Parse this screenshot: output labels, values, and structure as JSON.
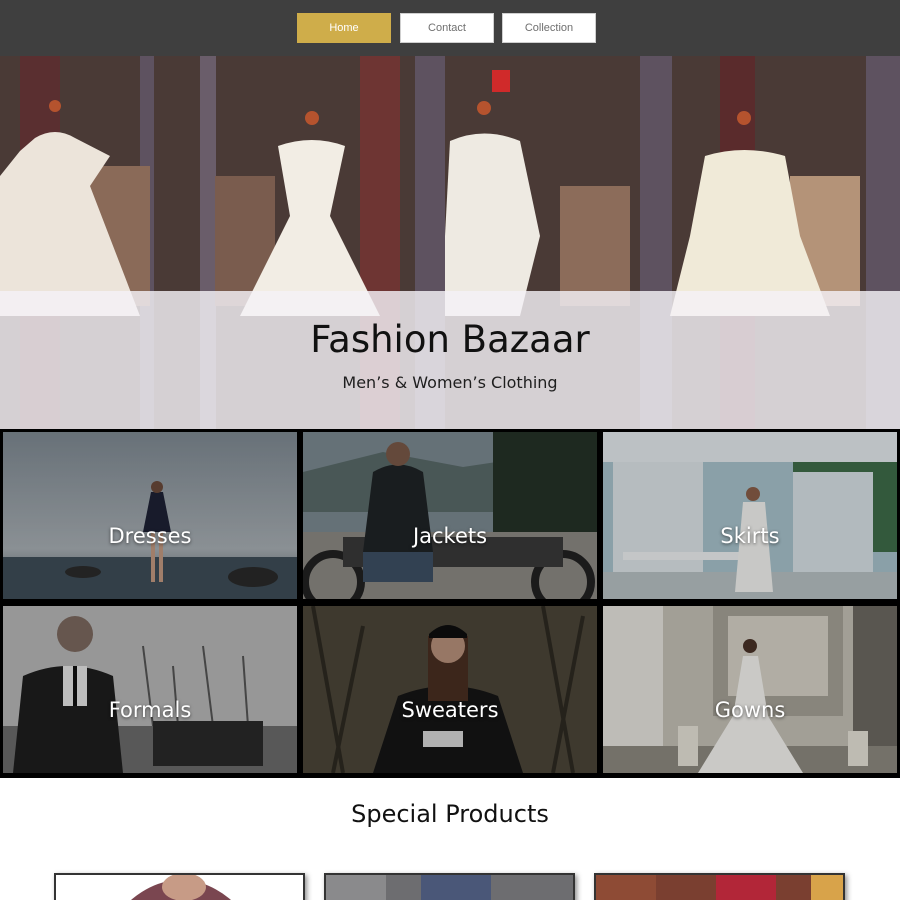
{
  "nav": {
    "items": [
      {
        "label": "Home",
        "active": true
      },
      {
        "label": "Contact",
        "active": false
      },
      {
        "label": "Collection",
        "active": false
      }
    ],
    "background": "#3f3f3f",
    "accent": "#cfad4a"
  },
  "hero": {
    "title": "Fashion Bazaar",
    "subtitle": "Men’s & Women’s Clothing"
  },
  "categories": [
    {
      "label": "Dresses",
      "icon": "photo-woman-dress-sea"
    },
    {
      "label": "Jackets",
      "icon": "photo-man-motorcycle"
    },
    {
      "label": "Skirts",
      "icon": "photo-woman-pavilion"
    },
    {
      "label": "Formals",
      "icon": "photo-man-suit"
    },
    {
      "label": "Sweaters",
      "icon": "photo-woman-sweater"
    },
    {
      "label": "Gowns",
      "icon": "photo-bride-gown"
    }
  ],
  "special": {
    "title": "Special Products"
  }
}
